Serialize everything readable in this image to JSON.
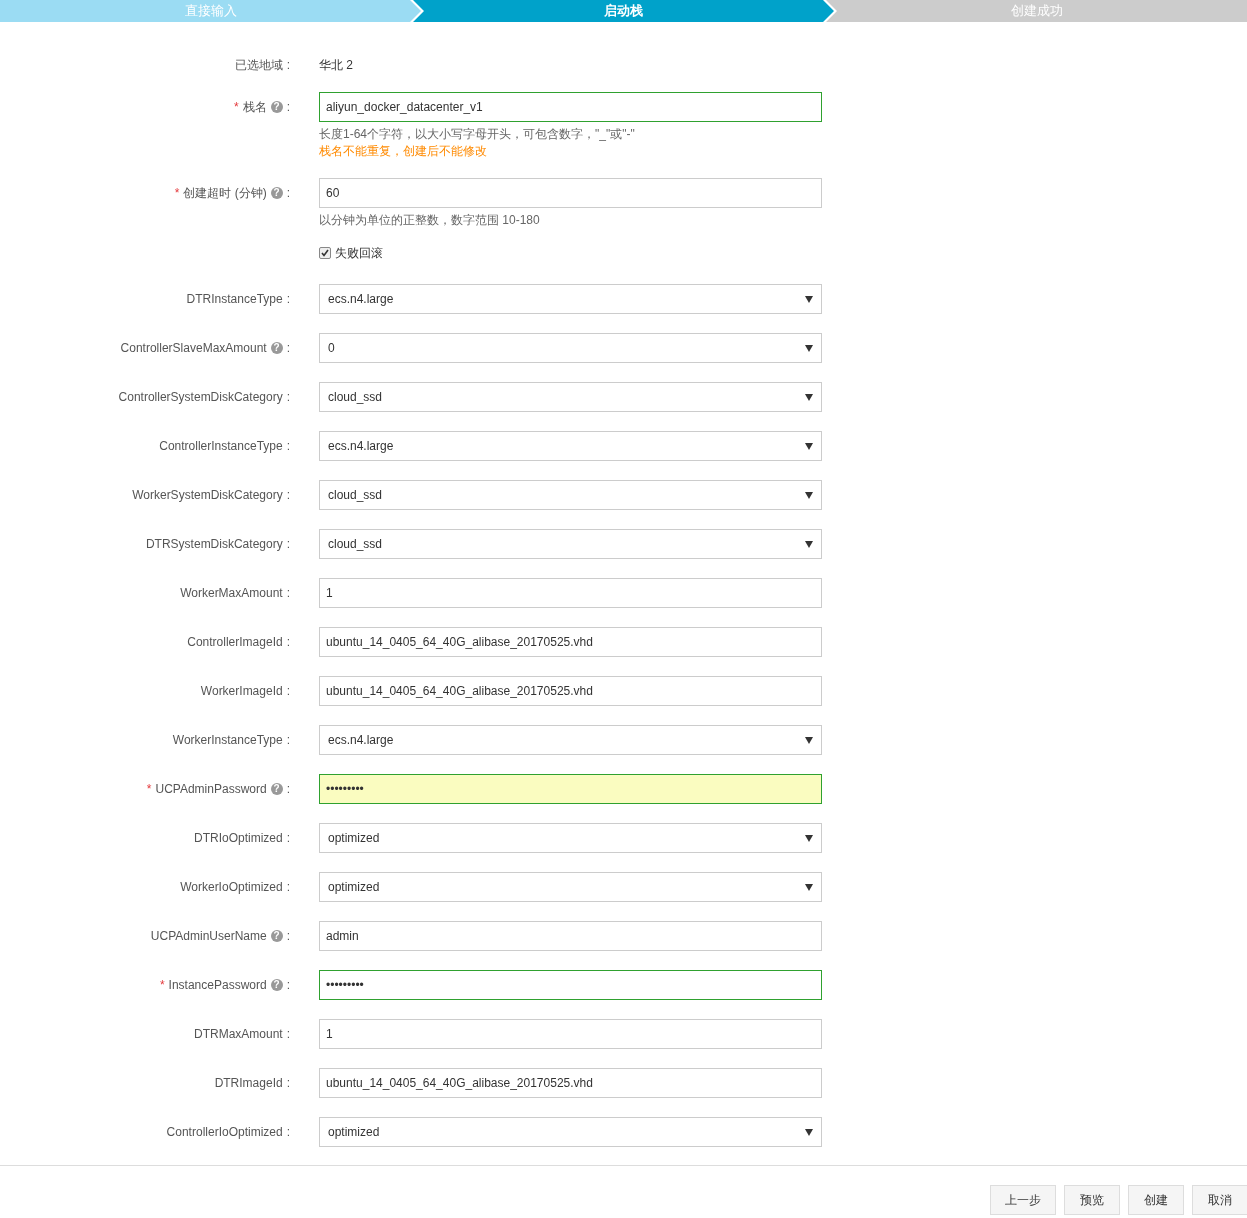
{
  "steps": [
    {
      "label": "直接输入",
      "completed": true,
      "selected": false
    },
    {
      "label": "启动栈",
      "completed": false,
      "selected": true
    },
    {
      "label": "创建成功",
      "completed": false,
      "selected": false
    }
  ],
  "fields": [
    {
      "kind": "static",
      "label": "已选地域",
      "suffix": ":",
      "value": "华北 2"
    },
    {
      "kind": "text",
      "required_mark": "*",
      "label": "栈名",
      "help": "?",
      "suffix": ":",
      "value": "aliyun_docker_datacenter_v1",
      "valid": true,
      "hints": [
        {
          "text": "长度1-64个字符，以大小写字母开头，可包含数字，\"_\"或\"-\"",
          "kind": "info"
        },
        {
          "text": "栈名不能重复，创建后不能修改",
          "kind": "warning"
        }
      ]
    },
    {
      "kind": "text",
      "required_mark": "*",
      "label": "创建超时 (分钟)",
      "help": "?",
      "suffix": ":",
      "value": "60",
      "hints": [
        {
          "text": "以分钟为单位的正整数，数字范围 10-180",
          "kind": "info"
        }
      ]
    },
    {
      "kind": "checkbox",
      "label": "失败回滚",
      "checked": true
    },
    {
      "kind": "select",
      "label": "DTRInstanceType",
      "suffix": ":",
      "value": "ecs.n4.large"
    },
    {
      "kind": "select",
      "label": "ControllerSlaveMaxAmount",
      "help": "?",
      "suffix": ":",
      "value": "0"
    },
    {
      "kind": "select",
      "label": "ControllerSystemDiskCategory",
      "suffix": ":",
      "value": "cloud_ssd"
    },
    {
      "kind": "select",
      "label": "ControllerInstanceType",
      "suffix": ":",
      "value": "ecs.n4.large"
    },
    {
      "kind": "select",
      "label": "WorkerSystemDiskCategory",
      "suffix": ":",
      "value": "cloud_ssd"
    },
    {
      "kind": "select",
      "label": "DTRSystemDiskCategory",
      "suffix": ":",
      "value": "cloud_ssd"
    },
    {
      "kind": "text",
      "label": "WorkerMaxAmount",
      "suffix": ":",
      "value": "1"
    },
    {
      "kind": "text",
      "label": "ControllerImageId",
      "suffix": ":",
      "value": "ubuntu_14_0405_64_40G_alibase_20170525.vhd"
    },
    {
      "kind": "text",
      "label": "WorkerImageId",
      "suffix": ":",
      "value": "ubuntu_14_0405_64_40G_alibase_20170525.vhd"
    },
    {
      "kind": "select",
      "label": "WorkerInstanceType",
      "suffix": ":",
      "value": "ecs.n4.large"
    },
    {
      "kind": "password",
      "required_mark": "*",
      "label": "UCPAdminPassword",
      "help": "?",
      "suffix": ":",
      "value": "•••••••••",
      "valid": true,
      "autofilled": true
    },
    {
      "kind": "select",
      "label": "DTRIoOptimized",
      "suffix": ":",
      "value": "optimized"
    },
    {
      "kind": "select",
      "label": "WorkerIoOptimized",
      "suffix": ":",
      "value": "optimized"
    },
    {
      "kind": "text",
      "label": "UCPAdminUserName",
      "help": "?",
      "suffix": ":",
      "value": "admin"
    },
    {
      "kind": "password",
      "required_mark": "*",
      "label": "InstancePassword",
      "help": "?",
      "suffix": ":",
      "value": "•••••••••",
      "valid": true
    },
    {
      "kind": "text",
      "label": "DTRMaxAmount",
      "suffix": ":",
      "value": "1"
    },
    {
      "kind": "text",
      "label": "DTRImageId",
      "suffix": ":",
      "value": "ubuntu_14_0405_64_40G_alibase_20170525.vhd"
    },
    {
      "kind": "select",
      "label": "ControllerIoOptimized",
      "suffix": ":",
      "value": "optimized"
    }
  ],
  "buttons": [
    "上一步",
    "预览",
    "创建",
    "取消"
  ]
}
